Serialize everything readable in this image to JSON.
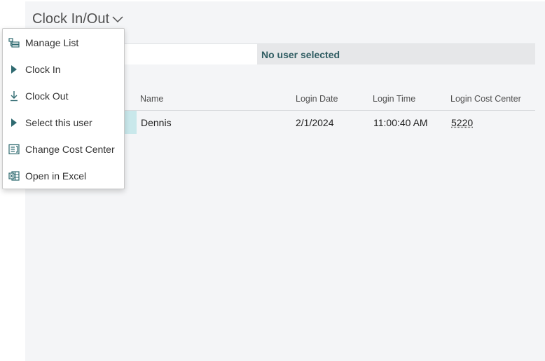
{
  "page": {
    "title": "Clock In/Out"
  },
  "info_bar": {
    "message": "No user selected"
  },
  "table": {
    "columns": [
      "Name",
      "Login Date",
      "Login Time",
      "Login Cost Center"
    ],
    "rows": [
      {
        "name": "Dennis",
        "login_date": "2/1/2024",
        "login_time": "11:00:40 AM",
        "login_cost_center": "5220"
      }
    ]
  },
  "menu": {
    "items": [
      {
        "label": "Manage List",
        "icon": "manage-list-icon"
      },
      {
        "label": "Clock In",
        "icon": "play-icon"
      },
      {
        "label": "Clock Out",
        "icon": "download-arrow-icon"
      },
      {
        "label": "Select this user",
        "icon": "play-icon"
      },
      {
        "label": "Change Cost Center",
        "icon": "change-cost-center-icon"
      },
      {
        "label": "Open in Excel",
        "icon": "excel-icon"
      }
    ]
  },
  "colors": {
    "icon_teal": "#2f6a70",
    "selected_row": "#c9e8eb",
    "info_text": "#2f5c62",
    "page_background": "#f4f5f7"
  }
}
